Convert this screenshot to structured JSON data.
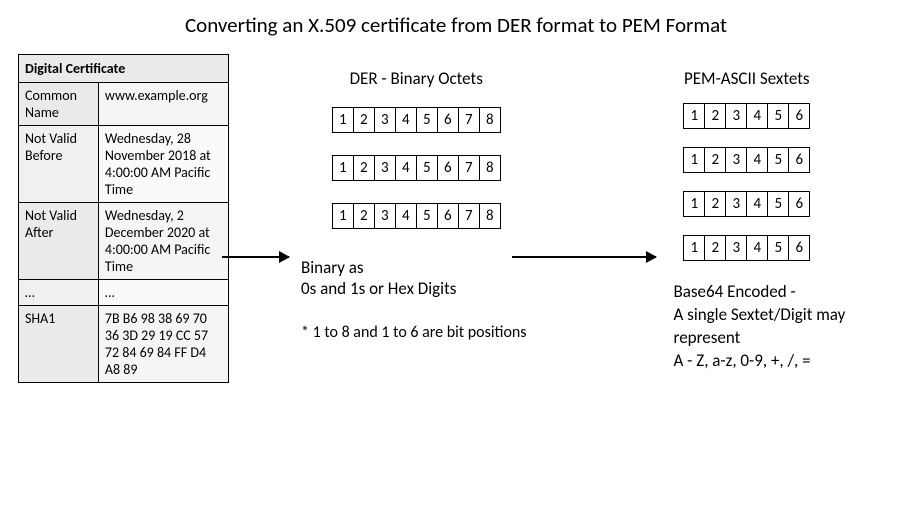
{
  "title": "Converting an X.509 certificate from DER format to PEM Format",
  "cert": {
    "header": "Digital Certificate",
    "rows": [
      {
        "key": "Common Name",
        "val": "www.example.org"
      },
      {
        "key": "Not Valid Before",
        "val": "Wednesday, 28 November 2018 at 4:00:00 AM Pacific Time"
      },
      {
        "key": "Not Valid After",
        "val": "Wednesday, 2 December 2020 at 4:00:00 AM Pacific Time"
      },
      {
        "key": "…",
        "val": "…"
      },
      {
        "key": "SHA1",
        "val": "7B B6 98 38 69 70 36 3D 29 19 CC 57 72 84 69 84 FF D4 A8 89"
      }
    ]
  },
  "der": {
    "title": "DER - Binary Octets",
    "bits": [
      "1",
      "2",
      "3",
      "4",
      "5",
      "6",
      "7",
      "8"
    ],
    "caption_line1": "Binary as",
    "caption_line2": "0s and 1s or Hex Digits",
    "footnote": "* 1 to 8 and 1 to 6 are bit positions"
  },
  "pem": {
    "title": "PEM-ASCII Sextets",
    "bits": [
      "1",
      "2",
      "3",
      "4",
      "5",
      "6"
    ],
    "caption_line1": "Base64 Encoded -",
    "caption_line2": "A single Sextet/Digit may",
    "caption_line3": "represent",
    "caption_line4": "A - Z, a-z, 0-9, +, /, ="
  }
}
